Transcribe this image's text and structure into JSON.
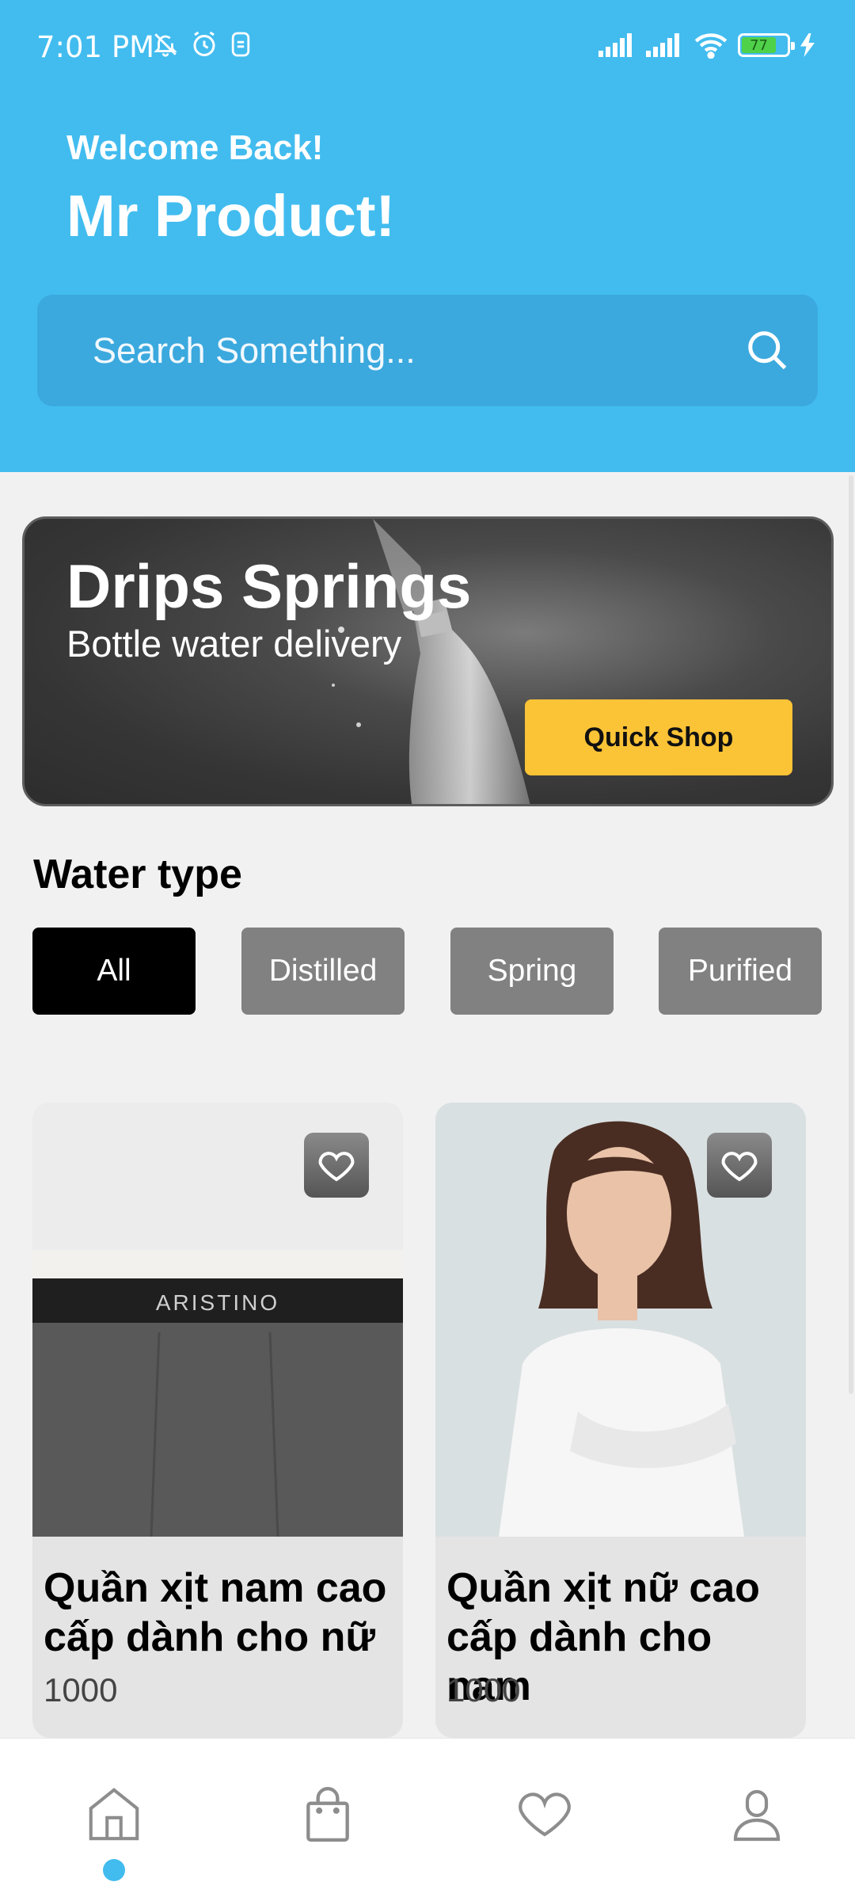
{
  "status_bar": {
    "time": "7:01 PM",
    "battery": "77"
  },
  "header": {
    "welcome": "Welcome Back!",
    "username": "Mr Product!",
    "search_placeholder": "Search Something..."
  },
  "banner": {
    "title": "Drips Springs",
    "subtitle": "Bottle water delivery",
    "button": "Quick Shop"
  },
  "water_type": {
    "title": "Water type",
    "chips": [
      {
        "label": "All",
        "active": true
      },
      {
        "label": "Distilled",
        "active": false
      },
      {
        "label": "Spring",
        "active": false
      },
      {
        "label": "Purified",
        "active": false
      }
    ]
  },
  "products": [
    {
      "name": "Quần xịt nam cao cấp dành cho nữ",
      "price": "1000",
      "image_text": "ARISTINO"
    },
    {
      "name": "Quần xịt nữ cao cấp dành cho nam",
      "price": "1000"
    }
  ],
  "bottom_nav": [
    "home-icon",
    "bag-icon",
    "heart-icon",
    "profile-icon"
  ],
  "colors": {
    "header": "#42bcef",
    "accent_button": "#fbc336",
    "chip_active": "#000000",
    "chip_inactive": "#818181"
  }
}
